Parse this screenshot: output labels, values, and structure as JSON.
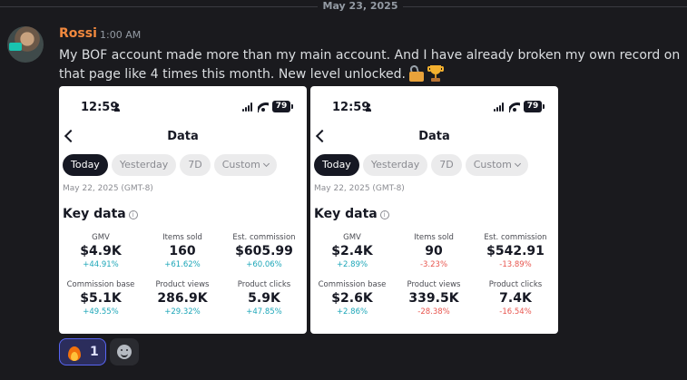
{
  "date_divider": "May 23, 2025",
  "message": {
    "author": "Rossi",
    "time": "1:00 AM",
    "text": "My BOF account made more than my main account. And I have already broken my own record on that page like 4 times this month. New level unlocked.",
    "emojis": [
      "unlock-icon",
      "trophy-icon"
    ],
    "colors": {
      "author": "#f0883e",
      "background": "#1a1a1e"
    }
  },
  "screenshots": [
    {
      "status_time": "12:59",
      "battery": "79",
      "title": "Data",
      "filters": [
        "Today",
        "Yesterday",
        "7D",
        "Custom"
      ],
      "active_filter": "Today",
      "date": "May 22, 2025 (GMT-8)",
      "section": "Key data",
      "metrics": [
        {
          "label": "GMV",
          "value": "$4.9K",
          "delta": "+44.91%",
          "trend": "up"
        },
        {
          "label": "Items sold",
          "value": "160",
          "delta": "+61.62%",
          "trend": "up"
        },
        {
          "label": "Est. commission",
          "value": "$605.99",
          "delta": "+60.06%",
          "trend": "up"
        },
        {
          "label": "Commission base",
          "value": "$5.1K",
          "delta": "+49.55%",
          "trend": "up"
        },
        {
          "label": "Product views",
          "value": "286.9K",
          "delta": "+29.32%",
          "trend": "up"
        },
        {
          "label": "Product clicks",
          "value": "5.9K",
          "delta": "+47.85%",
          "trend": "up"
        }
      ]
    },
    {
      "status_time": "12:59",
      "battery": "79",
      "title": "Data",
      "filters": [
        "Today",
        "Yesterday",
        "7D",
        "Custom"
      ],
      "active_filter": "Today",
      "date": "May 22, 2025 (GMT-8)",
      "section": "Key data",
      "metrics": [
        {
          "label": "GMV",
          "value": "$2.4K",
          "delta": "+2.89%",
          "trend": "up"
        },
        {
          "label": "Items sold",
          "value": "90",
          "delta": "-3.23%",
          "trend": "down"
        },
        {
          "label": "Est. commission",
          "value": "$542.91",
          "delta": "-13.89%",
          "trend": "down"
        },
        {
          "label": "Commission base",
          "value": "$2.6K",
          "delta": "+2.86%",
          "trend": "up"
        },
        {
          "label": "Product views",
          "value": "339.5K",
          "delta": "-28.38%",
          "trend": "down"
        },
        {
          "label": "Product clicks",
          "value": "7.4K",
          "delta": "-16.54%",
          "trend": "down"
        }
      ]
    }
  ],
  "trend_colors": {
    "up": "#1ca6b8",
    "down": "#e8554e"
  },
  "reactions": [
    {
      "emoji": "fire-icon",
      "count": "1"
    }
  ]
}
